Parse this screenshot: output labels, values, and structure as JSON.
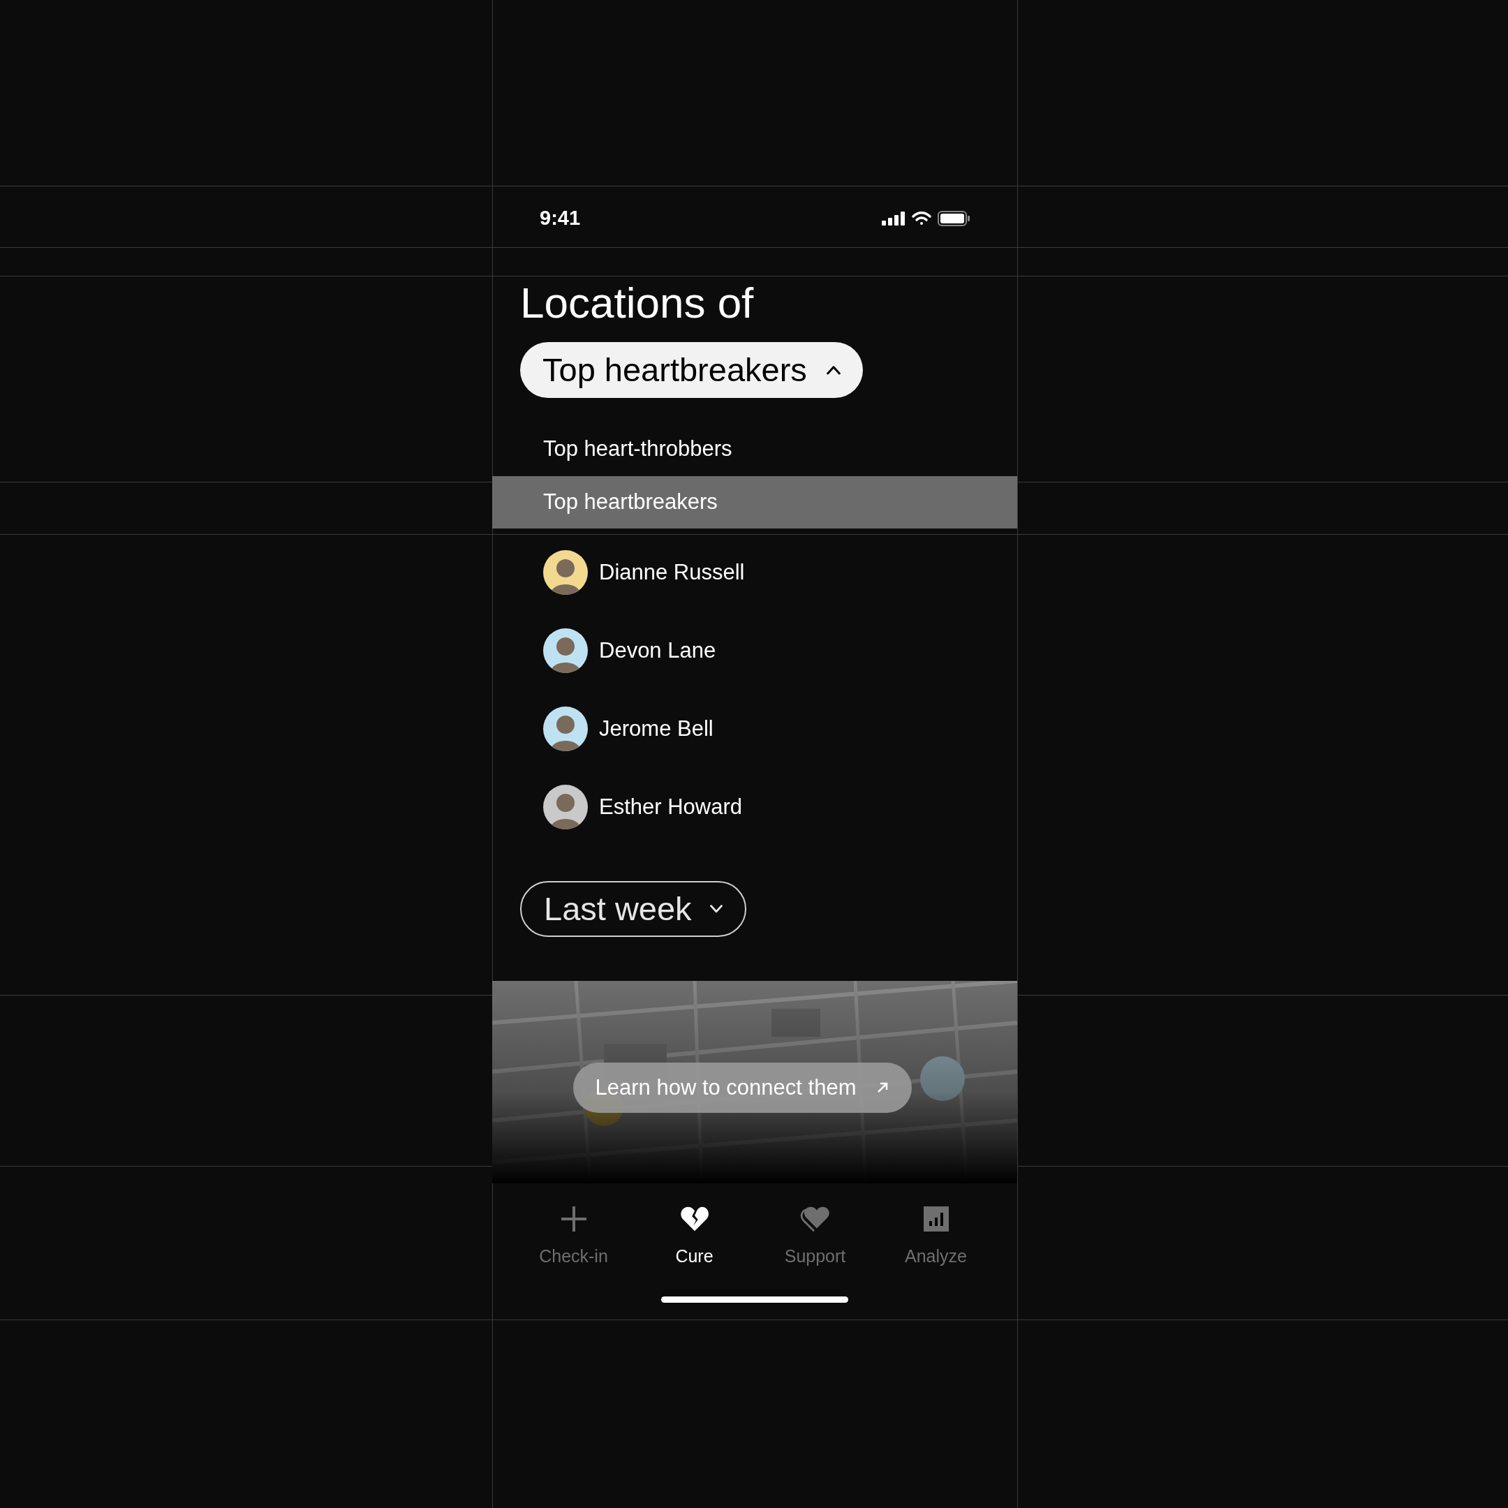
{
  "status_bar": {
    "time": "9:41"
  },
  "title": "Locations of",
  "category_dropdown": {
    "value": "Top heartbreakers",
    "expanded": true
  },
  "options": [
    {
      "label": "Top heart-throbbers",
      "selected": false
    },
    {
      "label": "Top heartbreakers",
      "selected": true
    }
  ],
  "people": [
    {
      "name": "Dianne Russell",
      "color": "#f3d98f"
    },
    {
      "name": "Devon Lane",
      "color": "#bfe2f2"
    },
    {
      "name": "Jerome Bell",
      "color": "#bfe2f2"
    },
    {
      "name": "Esther Howard",
      "color": "#c9c9c9"
    }
  ],
  "period_dropdown": {
    "value": "Last week",
    "expanded": false
  },
  "map": {
    "kind": "picture",
    "button": "Learn how to connect them"
  },
  "tabs": [
    {
      "label": "Check-in",
      "selected": false
    },
    {
      "label": "Cure",
      "selected": true
    },
    {
      "label": "Support",
      "selected": false
    },
    {
      "label": "Analyze",
      "selected": false
    }
  ]
}
